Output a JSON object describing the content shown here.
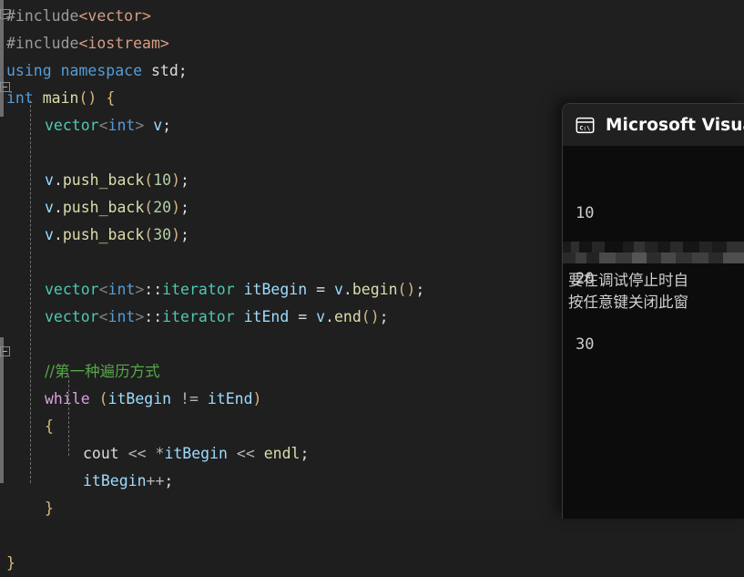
{
  "editor": {
    "language": "cpp",
    "background_color": "#1f1f1f",
    "code_lines": [
      {
        "indent": 0,
        "tokens": [
          {
            "t": "pp",
            "s": "#include"
          },
          {
            "t": "str",
            "s": "<vector>"
          }
        ]
      },
      {
        "indent": 0,
        "tokens": [
          {
            "t": "pp",
            "s": "#include"
          },
          {
            "t": "str",
            "s": "<iostream>"
          }
        ]
      },
      {
        "indent": 0,
        "tokens": [
          {
            "t": "kw",
            "s": "using"
          },
          {
            "t": "plain",
            "s": " "
          },
          {
            "t": "kw",
            "s": "namespace"
          },
          {
            "t": "plain",
            "s": " std;"
          }
        ]
      },
      {
        "indent": 0,
        "tokens": [
          {
            "t": "kw",
            "s": "int"
          },
          {
            "t": "plain",
            "s": " "
          },
          {
            "t": "fn",
            "s": "main"
          },
          {
            "t": "paren",
            "s": "()"
          },
          {
            "t": "plain",
            "s": " "
          },
          {
            "t": "brace",
            "s": "{"
          }
        ]
      },
      {
        "indent": 1,
        "tokens": [
          {
            "t": "type",
            "s": "vector"
          },
          {
            "t": "angle",
            "s": "<"
          },
          {
            "t": "kw",
            "s": "int"
          },
          {
            "t": "angle",
            "s": ">"
          },
          {
            "t": "plain",
            "s": " "
          },
          {
            "t": "var",
            "s": "v"
          },
          {
            "t": "plain",
            "s": ";"
          }
        ]
      },
      {
        "indent": 1,
        "tokens": []
      },
      {
        "indent": 1,
        "tokens": [
          {
            "t": "var",
            "s": "v"
          },
          {
            "t": "plain",
            "s": "."
          },
          {
            "t": "fn",
            "s": "push_back"
          },
          {
            "t": "paren",
            "s": "("
          },
          {
            "t": "num",
            "s": "10"
          },
          {
            "t": "paren",
            "s": ")"
          },
          {
            "t": "plain",
            "s": ";"
          }
        ]
      },
      {
        "indent": 1,
        "tokens": [
          {
            "t": "var",
            "s": "v"
          },
          {
            "t": "plain",
            "s": "."
          },
          {
            "t": "fn",
            "s": "push_back"
          },
          {
            "t": "paren",
            "s": "("
          },
          {
            "t": "num",
            "s": "20"
          },
          {
            "t": "paren",
            "s": ")"
          },
          {
            "t": "plain",
            "s": ";"
          }
        ]
      },
      {
        "indent": 1,
        "tokens": [
          {
            "t": "var",
            "s": "v"
          },
          {
            "t": "plain",
            "s": "."
          },
          {
            "t": "fn",
            "s": "push_back"
          },
          {
            "t": "paren",
            "s": "("
          },
          {
            "t": "num",
            "s": "30"
          },
          {
            "t": "paren",
            "s": ")"
          },
          {
            "t": "plain",
            "s": ";"
          }
        ]
      },
      {
        "indent": 1,
        "tokens": []
      },
      {
        "indent": 1,
        "tokens": [
          {
            "t": "type",
            "s": "vector"
          },
          {
            "t": "angle",
            "s": "<"
          },
          {
            "t": "kw",
            "s": "int"
          },
          {
            "t": "angle",
            "s": ">"
          },
          {
            "t": "plain",
            "s": "::"
          },
          {
            "t": "type",
            "s": "iterator"
          },
          {
            "t": "plain",
            "s": " "
          },
          {
            "t": "var",
            "s": "itBegin"
          },
          {
            "t": "plain",
            "s": " = "
          },
          {
            "t": "var",
            "s": "v"
          },
          {
            "t": "plain",
            "s": "."
          },
          {
            "t": "fn",
            "s": "begin"
          },
          {
            "t": "paren",
            "s": "()"
          },
          {
            "t": "plain",
            "s": ";"
          }
        ]
      },
      {
        "indent": 1,
        "tokens": [
          {
            "t": "type",
            "s": "vector"
          },
          {
            "t": "angle",
            "s": "<"
          },
          {
            "t": "kw",
            "s": "int"
          },
          {
            "t": "angle",
            "s": ">"
          },
          {
            "t": "plain",
            "s": "::"
          },
          {
            "t": "type",
            "s": "iterator"
          },
          {
            "t": "plain",
            "s": " "
          },
          {
            "t": "var",
            "s": "itEnd"
          },
          {
            "t": "plain",
            "s": " = "
          },
          {
            "t": "var",
            "s": "v"
          },
          {
            "t": "plain",
            "s": "."
          },
          {
            "t": "fn",
            "s": "end"
          },
          {
            "t": "paren",
            "s": "()"
          },
          {
            "t": "plain",
            "s": ";"
          }
        ]
      },
      {
        "indent": 1,
        "tokens": []
      },
      {
        "indent": 1,
        "tokens": [
          {
            "t": "comment",
            "s": "//第一种遍历方式",
            "cjk": true
          }
        ]
      },
      {
        "indent": 1,
        "tokens": [
          {
            "t": "kw2",
            "s": "while"
          },
          {
            "t": "plain",
            "s": " "
          },
          {
            "t": "paren",
            "s": "("
          },
          {
            "t": "var",
            "s": "itBegin"
          },
          {
            "t": "plain",
            "s": " "
          },
          {
            "t": "op",
            "s": "!="
          },
          {
            "t": "plain",
            "s": " "
          },
          {
            "t": "var",
            "s": "itEnd"
          },
          {
            "t": "paren",
            "s": ")"
          }
        ]
      },
      {
        "indent": 1,
        "tokens": [
          {
            "t": "brace",
            "s": "{"
          }
        ]
      },
      {
        "indent": 2,
        "tokens": [
          {
            "t": "plain",
            "s": "cout"
          },
          {
            "t": "plain",
            "s": " "
          },
          {
            "t": "op",
            "s": "<<"
          },
          {
            "t": "plain",
            "s": " "
          },
          {
            "t": "op",
            "s": "*"
          },
          {
            "t": "var",
            "s": "itBegin"
          },
          {
            "t": "plain",
            "s": " "
          },
          {
            "t": "op",
            "s": "<<"
          },
          {
            "t": "plain",
            "s": " "
          },
          {
            "t": "fn",
            "s": "endl"
          },
          {
            "t": "plain",
            "s": ";"
          }
        ]
      },
      {
        "indent": 2,
        "tokens": [
          {
            "t": "var",
            "s": "itBegin"
          },
          {
            "t": "op",
            "s": "++"
          },
          {
            "t": "plain",
            "s": ";"
          }
        ]
      },
      {
        "indent": 1,
        "tokens": [
          {
            "t": "brace",
            "s": "}"
          }
        ]
      },
      {
        "indent": 0,
        "tokens": []
      },
      {
        "indent": 0,
        "tokens": [
          {
            "t": "brace",
            "s": "}"
          }
        ]
      }
    ],
    "fold_markers": [
      {
        "line": 0,
        "state": "expanded"
      },
      {
        "line": 3,
        "state": "expanded"
      },
      {
        "line": 14,
        "state": "expanded"
      }
    ]
  },
  "console": {
    "icon": "console-window-icon",
    "icon_label": "C:\\",
    "title": "Microsoft Visua",
    "title_full": "Microsoft Visual Studio 调试控制台",
    "output_lines": [
      "10",
      "20",
      "30"
    ],
    "censored_line": "",
    "message_lines": [
      "要在调试停止时自",
      "按任意键关闭此窗"
    ],
    "background_color": "#0c0c0c",
    "titlebar_color": "#202020"
  }
}
